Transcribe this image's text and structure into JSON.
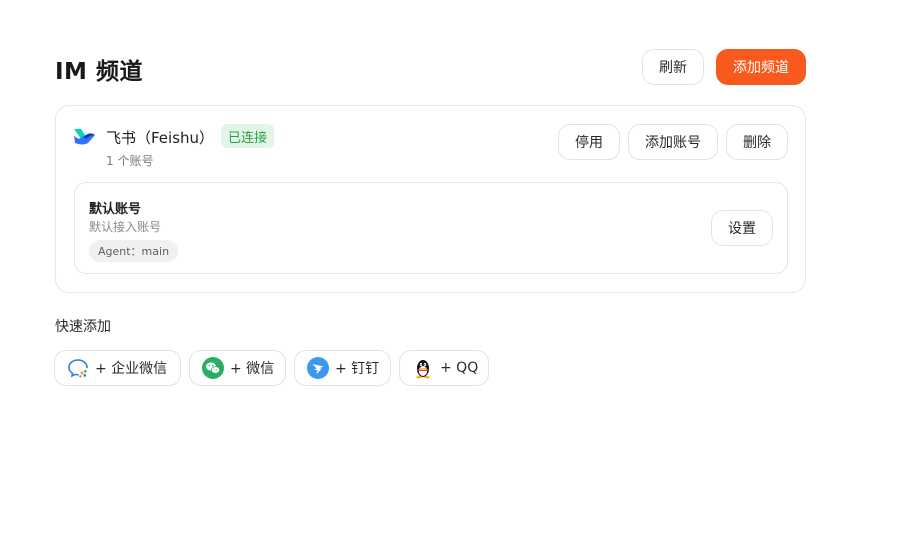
{
  "header": {
    "title": "IM 频道",
    "refresh_label": "刷新",
    "add_channel_label": "添加频道"
  },
  "channel": {
    "icon": "feishu-logo-icon",
    "name": "飞书（Feishu）",
    "status": "已连接",
    "account_count": "1 个账号",
    "disable_label": "停用",
    "add_account_label": "添加账号",
    "delete_label": "删除",
    "accounts": [
      {
        "title": "默认账号",
        "subtitle": "默认接入账号",
        "agent": "Agent：main",
        "settings_label": "设置"
      }
    ]
  },
  "quick_add": {
    "label": "快速添加",
    "items": [
      {
        "label": "+ 企业微信",
        "icon": "wecom-icon"
      },
      {
        "label": "+ 微信",
        "icon": "wechat-icon"
      },
      {
        "label": "+ 钉钉",
        "icon": "dingtalk-icon"
      },
      {
        "label": "+ QQ",
        "icon": "qq-icon"
      }
    ]
  },
  "colors": {
    "accent": "#f85a1e",
    "connected_bg": "#e3f5e6",
    "connected_text": "#2f9e4b"
  }
}
